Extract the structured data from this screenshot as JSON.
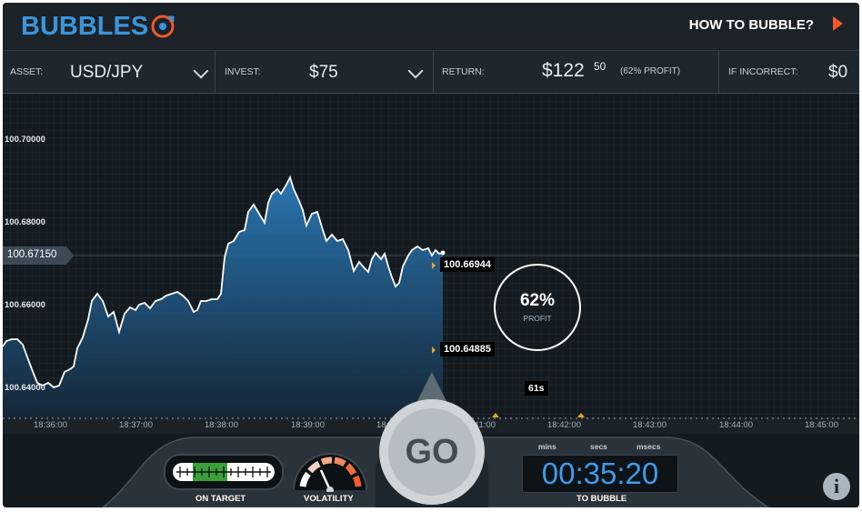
{
  "header": {
    "logo_text": "BUBBLES",
    "how_to_label": "HOW TO BUBBLE?"
  },
  "controls": {
    "asset_label": "ASSET:",
    "asset_value": "USD/JPY",
    "invest_label": "INVEST:",
    "invest_value": "$75",
    "return_label": "RETURN:",
    "return_value": "$122",
    "return_cents": "50",
    "return_profit": "(62% PROFIT)",
    "incorrect_label": "IF INCORRECT:",
    "incorrect_value": "$0"
  },
  "chart": {
    "price_labels": [
      "100.70000",
      "100.68000",
      "100.66000",
      "100.64000"
    ],
    "current_price": "100.67150",
    "upper_target": "100.66944",
    "lower_target": "100.64885",
    "profit_percent": "62%",
    "profit_label": "PROFIT",
    "countdown_tag": "61s",
    "time_labels": [
      "18:36:00",
      "18:37:00",
      "18:38:00",
      "18:39:00",
      "18:40:00",
      "18:41:00",
      "18:42:00",
      "18:43:00",
      "18:44:00",
      "18:45:00"
    ]
  },
  "bottom": {
    "on_target_label": "ON TARGET",
    "volatility_label": "VOLATILITY",
    "go_label": "GO",
    "timer_mins_label": "mins",
    "timer_secs_label": "secs",
    "timer_msecs_label": "msecs",
    "timer_value": "00:35:20",
    "to_bubble_label": "TO BUBBLE",
    "info_label": "i"
  },
  "colors": {
    "accent_blue": "#3d93d8",
    "accent_orange": "#f05a28",
    "chart_fill": "#2a7fbf",
    "ontarget_green": "#3aa13a"
  },
  "icons": {
    "logo_mark": "bullseye-icon",
    "how_to_arrow": "play-arrow-icon",
    "asset_chevron": "chevron-down-icon",
    "invest_chevron": "chevron-down-icon",
    "info": "info-icon"
  }
}
